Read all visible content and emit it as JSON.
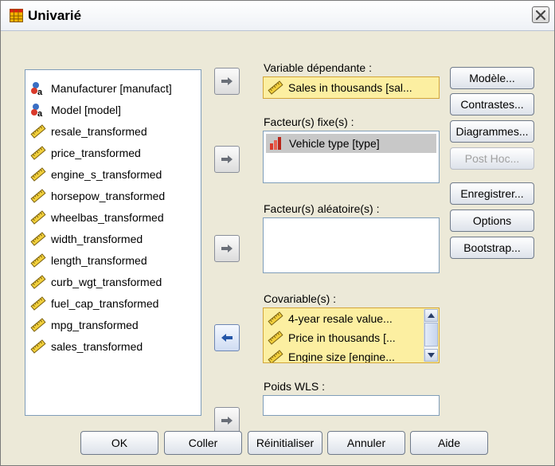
{
  "window": {
    "title": "Univarié",
    "close_icon": "close-icon"
  },
  "source_list": {
    "items": [
      {
        "label": "Manufacturer [manufact]",
        "icon": "nominal-icon"
      },
      {
        "label": "Model [model]",
        "icon": "nominal-icon"
      },
      {
        "label": "resale_transformed",
        "icon": "scale-icon"
      },
      {
        "label": "price_transformed",
        "icon": "scale-icon"
      },
      {
        "label": "engine_s_transformed",
        "icon": "scale-icon"
      },
      {
        "label": "horsepow_transformed",
        "icon": "scale-icon"
      },
      {
        "label": "wheelbas_transformed",
        "icon": "scale-icon"
      },
      {
        "label": "width_transformed",
        "icon": "scale-icon"
      },
      {
        "label": "length_transformed",
        "icon": "scale-icon"
      },
      {
        "label": "curb_wgt_transformed",
        "icon": "scale-icon"
      },
      {
        "label": "fuel_cap_transformed",
        "icon": "scale-icon"
      },
      {
        "label": "mpg_transformed",
        "icon": "scale-icon"
      },
      {
        "label": "sales_transformed",
        "icon": "scale-icon"
      }
    ]
  },
  "dependent": {
    "label": "Variable dépendante :",
    "value": "Sales in thousands [sal..."
  },
  "fixed": {
    "label": "Facteur(s) fixe(s) :",
    "items": [
      "Vehicle type [type]"
    ]
  },
  "random": {
    "label": "Facteur(s) aléatoire(s) :",
    "items": []
  },
  "covariates": {
    "label": "Covariable(s) :",
    "items": [
      "4-year resale value...",
      "Price in thousands [...",
      "Engine size [engine..."
    ]
  },
  "wls": {
    "label": "Poids WLS :",
    "value": ""
  },
  "side_buttons": {
    "model": "Modèle...",
    "contrasts": "Contrastes...",
    "plots": "Diagrammes...",
    "posthoc": "Post Hoc...",
    "save": "Enregistrer...",
    "options": "Options",
    "bootstrap": "Bootstrap..."
  },
  "bottom_buttons": {
    "ok": "OK",
    "paste": "Coller",
    "reset": "Réinitialiser",
    "cancel": "Annuler",
    "help": "Aide"
  },
  "colors": {
    "selected_fill": "#fcefa1",
    "selected_border": "#e0b84a",
    "highlight_fill": "#c8c8c8"
  }
}
